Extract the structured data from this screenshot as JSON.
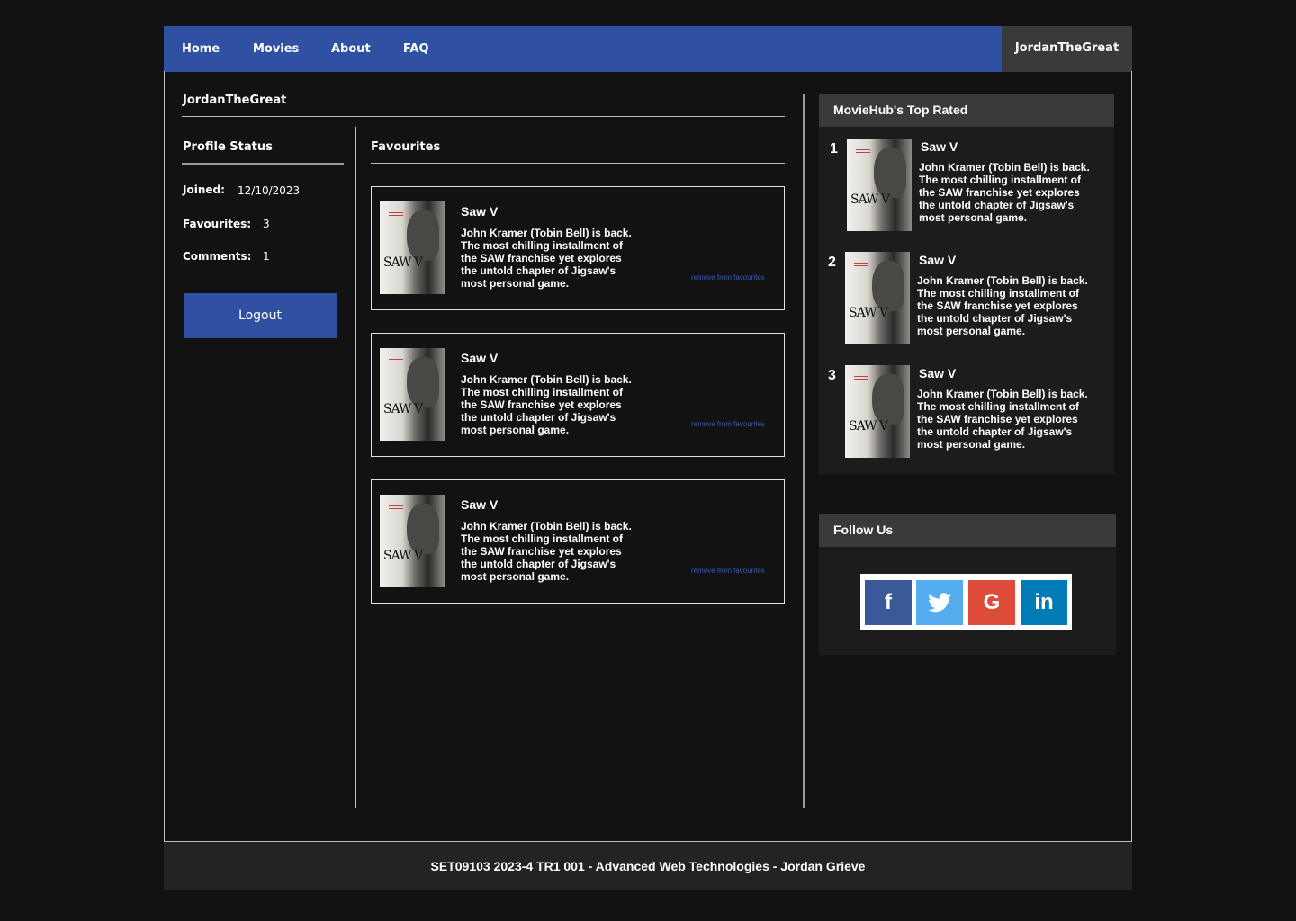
{
  "nav": {
    "links": [
      "Home",
      "Movies",
      "About",
      "FAQ"
    ],
    "user": "JordanTheGreat"
  },
  "profile": {
    "username": "JordanTheGreat",
    "status_title": "Profile Status",
    "joined_label": "Joined:",
    "joined_value": "12/10/2023",
    "favourites_label": "Favourites:",
    "favourites_value": "3",
    "comments_label": "Comments:",
    "comments_value": "1",
    "logout_label": "Logout"
  },
  "favourites": {
    "title": "Favourites",
    "remove_label": "remove from favourites",
    "items": [
      {
        "title": "Saw V",
        "poster_logo": "SAW V",
        "description": "John Kramer (Tobin Bell) is back. The most chilling installment of the SAW franchise yet explores the untold chapter of Jigsaw's most personal game."
      },
      {
        "title": "Saw V",
        "poster_logo": "SAW V",
        "description": "John Kramer (Tobin Bell) is back. The most chilling installment of the SAW franchise yet explores the untold chapter of Jigsaw's most personal game."
      },
      {
        "title": "Saw V",
        "poster_logo": "SAW V",
        "description": "John Kramer (Tobin Bell) is back. The most chilling installment of the SAW franchise yet explores the untold chapter of Jigsaw's most personal game."
      }
    ]
  },
  "top_rated": {
    "title": "MovieHub's Top Rated",
    "items": [
      {
        "rank": "1",
        "title": "Saw V",
        "poster_logo": "SAW V",
        "description": "John Kramer (Tobin Bell) is back. The most chilling installment of the SAW franchise yet explores the untold chapter of Jigsaw's most personal game."
      },
      {
        "rank": "2",
        "title": "Saw V",
        "poster_logo": "SAW V",
        "description": "John Kramer (Tobin Bell) is back. The most chilling installment of the SAW franchise yet explores the untold chapter of Jigsaw's most personal game."
      },
      {
        "rank": "3",
        "title": "Saw V",
        "poster_logo": "SAW V",
        "description": "John Kramer (Tobin Bell) is back. The most chilling installment of the SAW franchise yet explores the untold chapter of Jigsaw's most personal game."
      }
    ]
  },
  "follow": {
    "title": "Follow Us",
    "icons": [
      {
        "name": "facebook-icon",
        "glyph": "f",
        "color": "#3b5998"
      },
      {
        "name": "twitter-icon",
        "glyph": "🐦",
        "color": "#55acee"
      },
      {
        "name": "google-icon",
        "glyph": "G",
        "color": "#dd4b39"
      },
      {
        "name": "linkedin-icon",
        "glyph": "in",
        "color": "#007bb5"
      }
    ]
  },
  "footer": {
    "text": "SET09103 2023-4 TR1 001 - Advanced Web Technologies - Jordan Grieve"
  },
  "colors": {
    "brand_blue": "#3050a4",
    "background": "#121212",
    "panel": "#1c1c1c",
    "panel_header": "#3a3a3a"
  }
}
